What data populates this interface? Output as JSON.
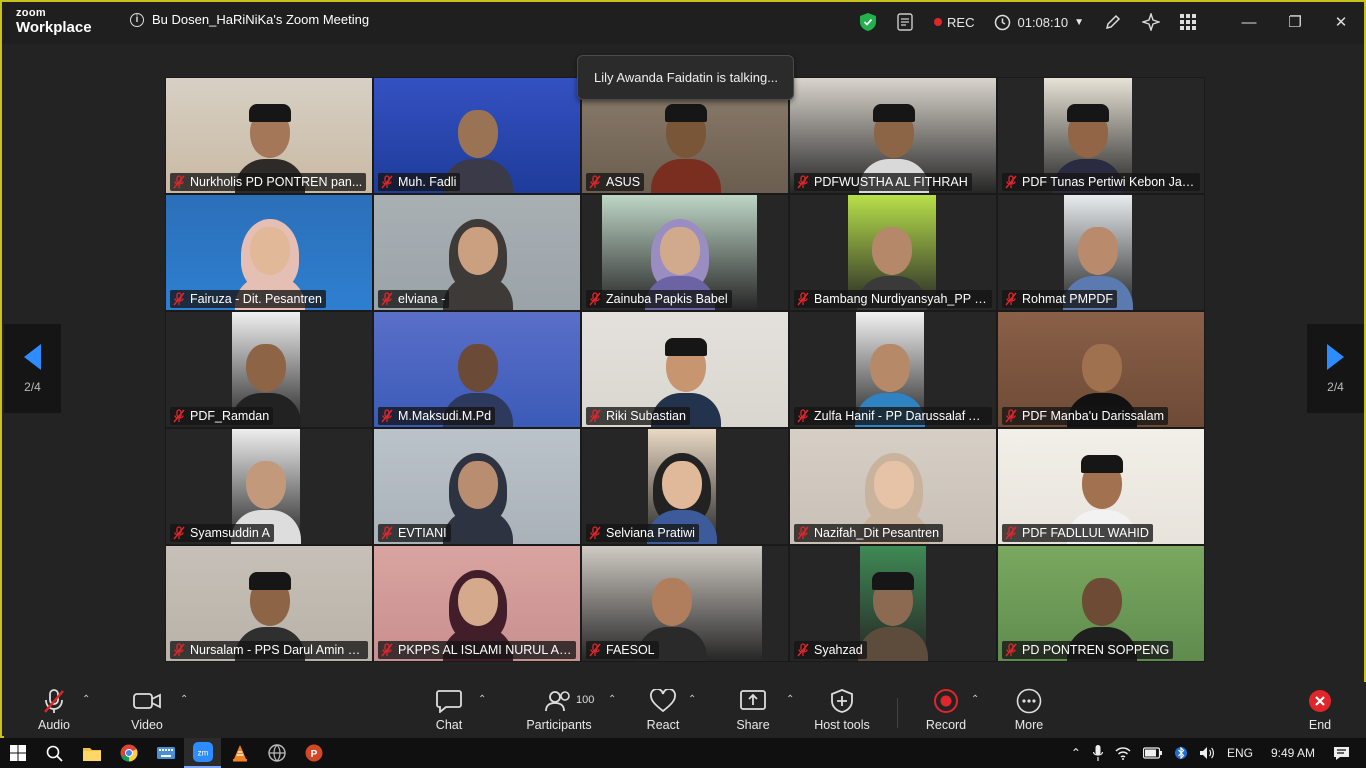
{
  "app": {
    "brand_top": "zoom",
    "brand_bottom": "Workplace",
    "meeting_title": "Bu Dosen_HaRiNiKa's Zoom Meeting"
  },
  "titlebar": {
    "rec_label": "REC",
    "timer": "01:08:10"
  },
  "talking_indicator": "Lily Awanda Faidatin is talking...",
  "pager": {
    "left_label": "2/4",
    "right_label": "2/4"
  },
  "participants": [
    {
      "name": "Nurkholis PD PONTREN  pan..."
    },
    {
      "name": "Muh. Fadli"
    },
    {
      "name": "ASUS"
    },
    {
      "name": "PDFWUSTHA AL FITHRAH"
    },
    {
      "name": "PDF Tunas Pertiwi Kebon Jam..."
    },
    {
      "name": "Fairuza - Dit. Pesantren"
    },
    {
      "name": "elviana -"
    },
    {
      "name": "Zainuba Papkis Babel"
    },
    {
      "name": "Bambang Nurdiyansyah_PP Bi..."
    },
    {
      "name": "Rohmat PMPDF"
    },
    {
      "name": "PDF_Ramdan"
    },
    {
      "name": "M.Maksudi.M.Pd"
    },
    {
      "name": "Riki Subastian"
    },
    {
      "name": "Zulfa Hanif - PP Darussalaf Al ..."
    },
    {
      "name": "PDF Manba'u Darissalam"
    },
    {
      "name": "Syamsuddin A"
    },
    {
      "name": "EVTIANI"
    },
    {
      "name": "Selviana Pratiwi"
    },
    {
      "name": "Nazifah_Dit Pesantren"
    },
    {
      "name": "PDF FADLLUL WAHID"
    },
    {
      "name": "Nursalam - PPS Darul Amin - ..."
    },
    {
      "name": "PKPPS AL ISLAMI NURUL AN..."
    },
    {
      "name": "FAESOL"
    },
    {
      "name": "Syahzad"
    },
    {
      "name": "PD PONTREN SOPPENG"
    }
  ],
  "toolbar": {
    "audio": "Audio",
    "video": "Video",
    "chat": "Chat",
    "participants": "Participants",
    "participants_count": "100",
    "react": "React",
    "share": "Share",
    "host_tools": "Host tools",
    "record": "Record",
    "more": "More",
    "end": "End"
  },
  "taskbar": {
    "language": "ENG",
    "time": "9:49 AM"
  },
  "colors": {
    "accent": "#2d8cff",
    "frame": "#c9c21a",
    "muted": "#e0262b"
  }
}
